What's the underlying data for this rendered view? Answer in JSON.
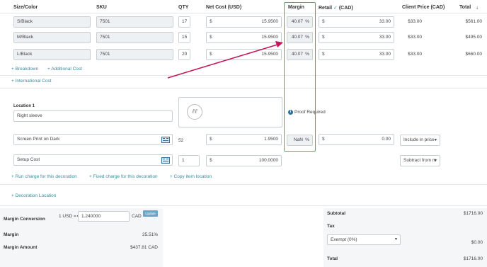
{
  "headers": {
    "size_color": "Size/Color",
    "sku": "SKU",
    "qty": "QTY",
    "net_cost": "Net Cost (USD)",
    "margin": "Margin",
    "retail": "Retail",
    "retail_cur": "(CAD)",
    "client_price": "Client Price (CAD)",
    "total": "Total",
    "sort_icon": "arrow-down-icon"
  },
  "rows": [
    {
      "size": "S/Black",
      "sku": "7501",
      "qty": "17",
      "cur": "$",
      "net": "15.9500",
      "margin": "40.07",
      "pct": "%",
      "retail": "33.00",
      "client": "$33.00",
      "total": "$561.00"
    },
    {
      "size": "M/Black",
      "sku": "7501",
      "qty": "15",
      "cur": "$",
      "net": "15.9500",
      "margin": "40.07",
      "pct": "%",
      "retail": "33.00",
      "client": "$33.00",
      "total": "$495.00"
    },
    {
      "size": "L/Black",
      "sku": "7501",
      "qty": "20",
      "cur": "$",
      "net": "15.9500",
      "margin": "40.07",
      "pct": "%",
      "retail": "33.00",
      "client": "$33.00",
      "total": "$660.00"
    }
  ],
  "links": {
    "breakdown": "+ Breakdown",
    "additional_cost": "+ Additional Cost",
    "international_cost": "+ International Cost",
    "run_charge": "+ Run charge for this decoration",
    "fixed_charge": "+ Fixed charge for this decoration",
    "copy_location": "+ Copy item location",
    "decoration_location": "+ Decoration Location"
  },
  "decoration": {
    "location_label": "Location 1",
    "location_value": "Right sleeve",
    "proof_icon": "info-circle-icon",
    "proof_text": "Proof Required",
    "logo_icon": "signature-logo-icon",
    "rows": [
      {
        "name": "Screen Print on Dark",
        "qty": "52",
        "cur": "$",
        "net": "1.9500",
        "margin": "NaN",
        "pct": "%",
        "retail_cur": "$",
        "retail": "0.00",
        "option": "Include in price"
      },
      {
        "name": "Setup Cost",
        "qty": "1",
        "cur": "$",
        "net": "100.0000",
        "option": "Subtract from m"
      }
    ]
  },
  "summary": {
    "margin_conversion_label": "Margin Conversion",
    "usd_label": "1 USD =",
    "rate": "1.240000",
    "cad_label": "CAD",
    "update_button": "Update",
    "margin_label": "Margin",
    "margin_value": "25.51%",
    "margin_amount_label": "Margin Amount",
    "margin_amount_value": "$437.81 CAD"
  },
  "totals": {
    "subtotal_label": "Subtotal",
    "subtotal_value": "$1716.00",
    "tax_label": "Tax",
    "tax_option": "Exempt (0%)",
    "tax_value": "$0.00",
    "total_label": "Total",
    "total_value": "$1716.00"
  },
  "colors": {
    "highlight_box": "#3cb371",
    "arrow": "#c2185b",
    "link": "#3a8a9a",
    "update_button": "#6aa6c7"
  }
}
